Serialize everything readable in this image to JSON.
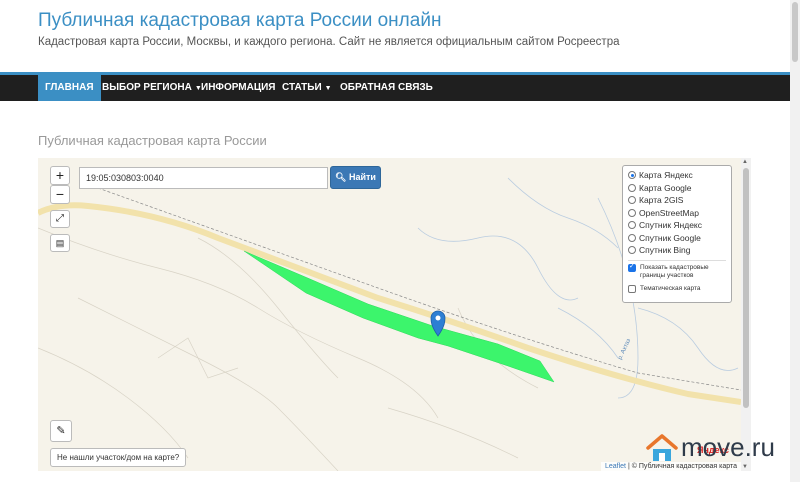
{
  "header": {
    "title": "Публичная кадастровая карта России онлайн",
    "subtitle": "Кадастровая карта России, Москвы, и каждого региона. Сайт не является официальным сайтом Росреестра"
  },
  "nav": {
    "items": [
      {
        "label": "ГЛАВНАЯ",
        "active": true
      },
      {
        "label": "ВЫБОР РЕГИОНА",
        "dropdown": true
      },
      {
        "label": "ИНФОРМАЦИЯ"
      },
      {
        "label": "СТАТЬИ",
        "dropdown": true
      },
      {
        "label": "ОБРАТНАЯ СВЯЗЬ"
      }
    ]
  },
  "page": {
    "heading": "Публичная кадастровая карта России"
  },
  "map": {
    "zoom_in": "+",
    "zoom_out": "−",
    "search_value": "19:05:030803:0040",
    "search_button": "Найти",
    "layers": [
      {
        "label": "Карта Яндекс",
        "selected": true
      },
      {
        "label": "Карта Google",
        "selected": false
      },
      {
        "label": "Карта 2GIS",
        "selected": false
      },
      {
        "label": "OpenStreetMap",
        "selected": false
      },
      {
        "label": "Спутник Яндекс",
        "selected": false
      },
      {
        "label": "Спутник Google",
        "selected": false
      },
      {
        "label": "Спутник Bing",
        "selected": false
      }
    ],
    "show_borders_label": "Показать кадастровые границы участков",
    "show_borders_checked": true,
    "thematic_label": "Тематическая карта",
    "thematic_checked": false,
    "not_found_button": "Не нашли участок/дом на карте?",
    "river_label": "р. Ахтаз",
    "provider_logo": "Яндекс",
    "attribution_leaflet": "Leaflet",
    "attribution_text": "© Публичная кадастровая карта",
    "plot_color": "#3cf56c"
  },
  "watermark": {
    "text": "move.ru",
    "icon": "house-logo-icon"
  }
}
